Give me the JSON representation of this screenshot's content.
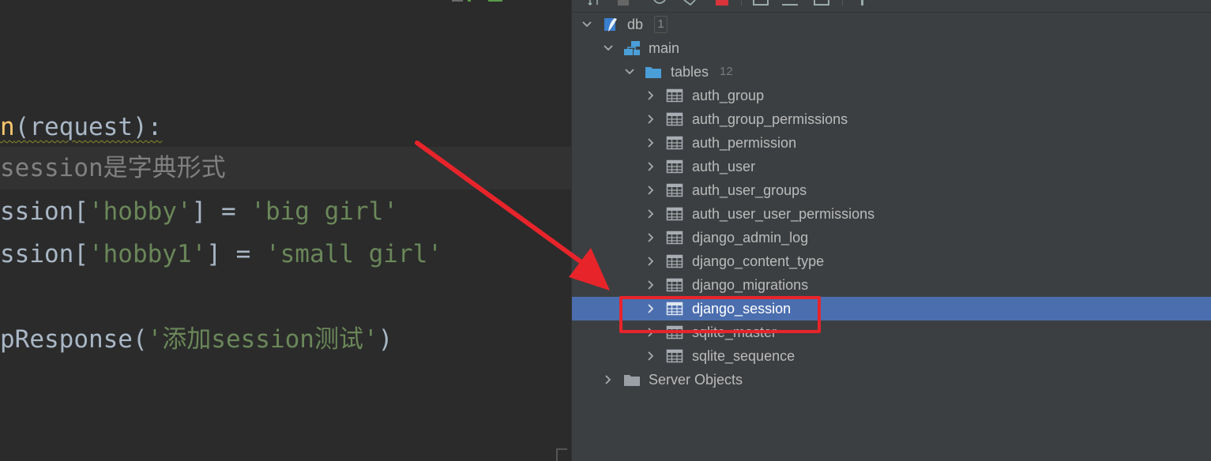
{
  "editor": {
    "lines": [
      {
        "parts": [
          {
            "t": "n",
            "k": "fn"
          },
          {
            "t": "(request):",
            "k": "plain"
          }
        ]
      },
      {
        "parts": [
          {
            "t": "session是字典形式",
            "k": "cmt"
          }
        ]
      },
      {
        "parts": [
          {
            "t": "ssion[",
            "k": "plain"
          },
          {
            "t": "'hobby'",
            "k": "str"
          },
          {
            "t": "] = ",
            "k": "plain"
          },
          {
            "t": "'big girl'",
            "k": "str"
          }
        ]
      },
      {
        "parts": [
          {
            "t": "ssion[",
            "k": "plain"
          },
          {
            "t": "'hobby1'",
            "k": "str"
          },
          {
            "t": "] = ",
            "k": "plain"
          },
          {
            "t": "'small girl'",
            "k": "str"
          }
        ]
      },
      {
        "parts": [
          {
            "t": "pResponse(",
            "k": "plain"
          },
          {
            "t": "'添加session测试'",
            "k": "str"
          },
          {
            "t": ")",
            "k": "plain"
          }
        ]
      }
    ]
  },
  "tree": {
    "db": {
      "label": "db",
      "count": "1"
    },
    "schema": {
      "label": "main"
    },
    "tables_folder": {
      "label": "tables",
      "count": "12"
    },
    "tables": [
      "auth_group",
      "auth_group_permissions",
      "auth_permission",
      "auth_user",
      "auth_user_groups",
      "auth_user_user_permissions",
      "django_admin_log",
      "django_content_type",
      "django_migrations",
      "django_session",
      "sqlite_master",
      "sqlite_sequence"
    ],
    "selected_table": "django_session",
    "server_objects": {
      "label": "Server Objects"
    }
  },
  "colors": {
    "editor_bg": "#2b2b2b",
    "panel_bg": "#3c3f41",
    "selection": "#4b6eaf",
    "annotation_red": "#e8242b",
    "string_green": "#6a8759",
    "function_yellow": "#ffc66d",
    "comment_gray": "#808080"
  }
}
